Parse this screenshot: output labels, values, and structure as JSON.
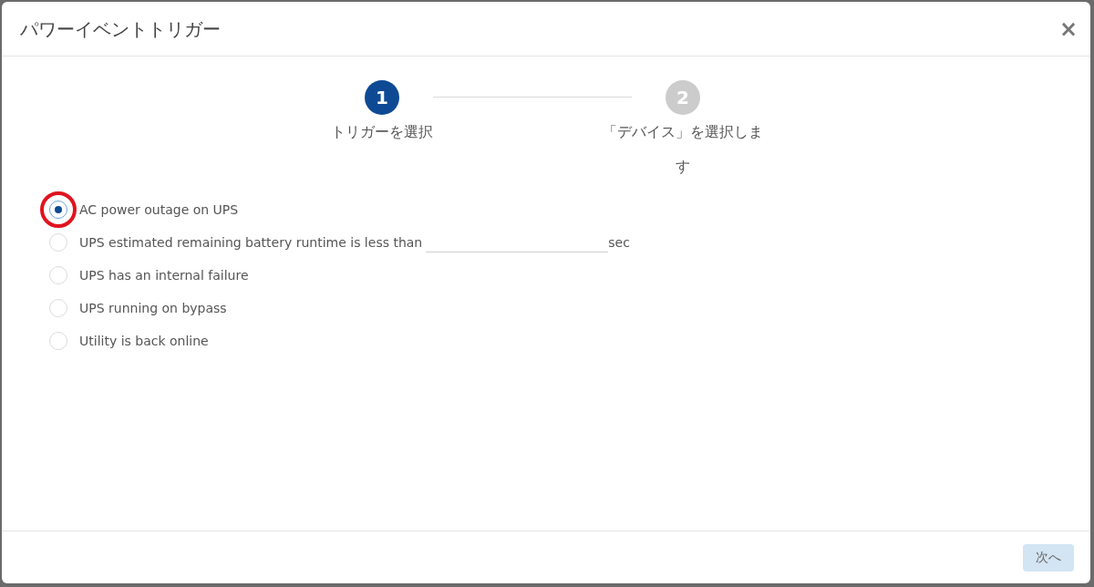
{
  "dialog": {
    "title": "パワーイベントトリガー",
    "close": "×"
  },
  "steps": [
    {
      "number": "1",
      "label": "トリガーを選択",
      "selected": true
    },
    {
      "number": "2",
      "label": "「デバイス」を選択します",
      "selected": false
    }
  ],
  "options": [
    {
      "kind": "plain",
      "label": "AC power outage on UPS",
      "selected": true,
      "highlighted": true
    },
    {
      "kind": "input",
      "label": "UPS estimated remaining battery runtime is less than",
      "unit": "sec",
      "selected": false,
      "highlighted": false
    },
    {
      "kind": "plain",
      "label": "UPS has an internal failure",
      "selected": false,
      "highlighted": false
    },
    {
      "kind": "plain",
      "label": "UPS running on bypass",
      "selected": false,
      "highlighted": false
    },
    {
      "kind": "plain",
      "label": "Utility is back online",
      "selected": false,
      "highlighted": false
    }
  ],
  "footer": {
    "next_button": {
      "label": "次へ",
      "disabled": true
    }
  }
}
